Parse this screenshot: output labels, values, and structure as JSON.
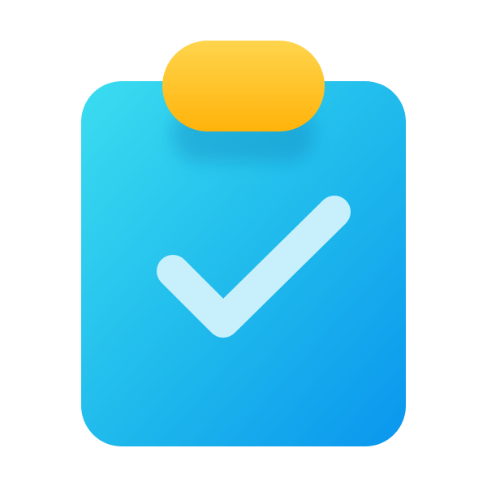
{
  "icon": {
    "name": "clipboard-check-icon",
    "colors": {
      "board_gradient_start": "#3BDDF0",
      "board_gradient_mid": "#1EB8EC",
      "board_gradient_end": "#0A96EE",
      "clip_gradient_top": "#FFD54D",
      "clip_gradient_bottom": "#FFB30A",
      "check": "#C8F0FC",
      "shadow": "#0F7FB8"
    }
  }
}
